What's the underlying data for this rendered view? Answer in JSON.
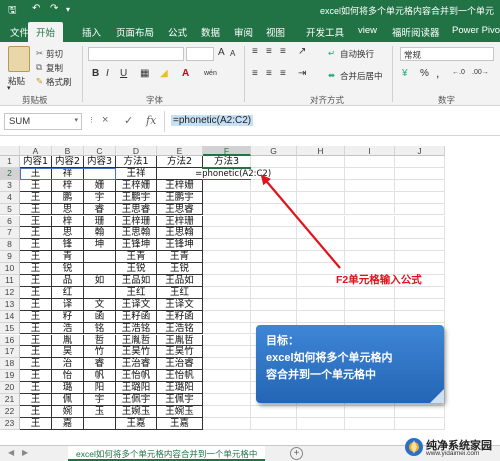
{
  "title_bar": {
    "title": "excel如何将多个单元格内容合并到一个单元",
    "quick_access": [
      "save-icon",
      "undo-icon",
      "redo-icon"
    ]
  },
  "ribbon_tabs": [
    "文件",
    "开始",
    "插入",
    "页面布局",
    "公式",
    "数据",
    "审阅",
    "视图",
    "开发工具",
    "view",
    "福昕阅读器",
    "Power Pivot"
  ],
  "active_tab": "开始",
  "ribbon": {
    "clipboard": {
      "paste": "粘贴",
      "cut": "剪切",
      "copy": "复制",
      "format_painter": "格式刷",
      "group": "剪贴板"
    },
    "font": {
      "group": "字体",
      "bold": "B",
      "italic": "I",
      "underline": "U",
      "grow": "A",
      "shrink": "A",
      "wen": "wén"
    },
    "alignment": {
      "wrap": "自动换行",
      "merge": "合并后居中",
      "group": "对齐方式"
    },
    "number": {
      "format": "常规",
      "percent": "%",
      "comma": ",",
      "group": "数字"
    }
  },
  "formula_bar": {
    "name_box": "SUM",
    "cancel": "×",
    "enter": "✓",
    "fx": "fx",
    "formula": "=phonetic(A2:C2)"
  },
  "columns": [
    "A",
    "B",
    "C",
    "D",
    "E",
    "F",
    "G",
    "H",
    "I",
    "J"
  ],
  "active_column": "F",
  "rows": [
    [
      "内容1",
      "内容2",
      "内容3",
      "方法1",
      "方法2",
      "方法3"
    ],
    [
      "王",
      "祥",
      "",
      "王祥",
      "",
      ""
    ],
    [
      "王",
      "梓",
      "姗",
      "王梓姗",
      "王梓姗",
      ""
    ],
    [
      "王",
      "鹏",
      "宇",
      "王鹏宇",
      "王鹏宇",
      ""
    ],
    [
      "王",
      "思",
      "睿",
      "王思睿",
      "王思睿",
      ""
    ],
    [
      "王",
      "梓",
      "珊",
      "王梓珊",
      "王梓珊",
      ""
    ],
    [
      "王",
      "思",
      "翰",
      "王思翰",
      "王思翰",
      ""
    ],
    [
      "王",
      "锋",
      "坤",
      "王锋坤",
      "王锋坤",
      ""
    ],
    [
      "王",
      "青",
      "",
      "王青",
      "王青",
      ""
    ],
    [
      "王",
      "锐",
      "",
      "王锐",
      "王锐",
      ""
    ],
    [
      "王",
      "品",
      "如",
      "王品如",
      "王品如",
      ""
    ],
    [
      "王",
      "红",
      "",
      "王红",
      "王红",
      ""
    ],
    [
      "王",
      "译",
      "文",
      "王译文",
      "王译文",
      ""
    ],
    [
      "王",
      "籽",
      "函",
      "王籽函",
      "王籽函",
      ""
    ],
    [
      "王",
      "浩",
      "铭",
      "王浩铭",
      "王浩铭",
      ""
    ],
    [
      "王",
      "胤",
      "哲",
      "王胤哲",
      "王胤哲",
      ""
    ],
    [
      "王",
      "昊",
      "竹",
      "王昊竹",
      "王昊竹",
      ""
    ],
    [
      "王",
      "治",
      "睿",
      "王治睿",
      "王治睿",
      ""
    ],
    [
      "王",
      "怡",
      "帆",
      "王怡帆",
      "王怡帆",
      ""
    ],
    [
      "王",
      "璐",
      "阳",
      "王璐阳",
      "王璐阳",
      ""
    ],
    [
      "王",
      "佩",
      "宇",
      "王佩宇",
      "王佩宇",
      ""
    ],
    [
      "王",
      "婉",
      "玉",
      "王婉玉",
      "王婉玉",
      ""
    ],
    [
      "王",
      "嘉",
      "",
      "王嘉",
      "王嘉",
      ""
    ]
  ],
  "active_cell": "F2",
  "active_cell_formula": "=phonetic(A2:C2)",
  "annotation_label": "F2单元格输入公式",
  "goal_box": {
    "heading": "目标：",
    "line1": "excel如何将多个单元格内",
    "line2": "容合并到一个单元格中"
  },
  "sheet_tab": "excel如何将多个单元格内容合并到一个单元格中",
  "add_sheet": "+",
  "watermark": {
    "text": "纯净系统家园",
    "url": "www.yidaimei.com"
  },
  "colors": {
    "excel_green": "#217346",
    "annotation_red": "#e0131c",
    "goal_blue": "#2f74c8"
  }
}
